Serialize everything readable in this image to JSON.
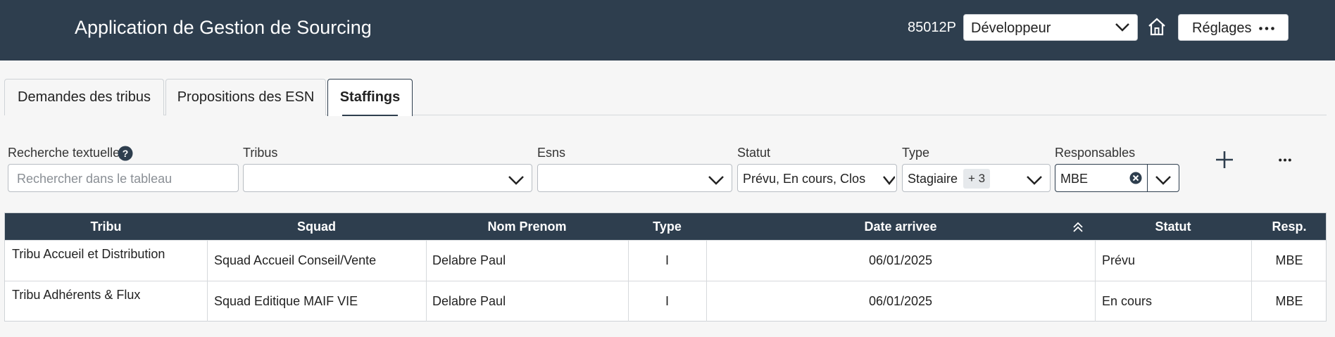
{
  "header": {
    "title": "Application de Gestion de Sourcing",
    "user_id": "85012P",
    "role": "Développeur",
    "settings_label": "Réglages"
  },
  "tabs": [
    {
      "label": "Demandes des tribus"
    },
    {
      "label": "Propositions des ESN"
    },
    {
      "label": "Staffings",
      "active": true
    }
  ],
  "filters": {
    "search": {
      "label": "Recherche textuelle",
      "placeholder": "Rechercher dans le tableau"
    },
    "tribus": {
      "label": "Tribus",
      "value": ""
    },
    "esns": {
      "label": "Esns",
      "value": ""
    },
    "statut": {
      "label": "Statut",
      "value": "Prévu, En cours, Clos"
    },
    "type": {
      "label": "Type",
      "value": "Stagiaire",
      "extra_count": "+ 3"
    },
    "responsables": {
      "label": "Responsables",
      "value": "MBE"
    }
  },
  "table": {
    "columns": [
      "Tribu",
      "Squad",
      "Nom Prenom",
      "Type",
      "Date arrivee",
      "Statut",
      "Resp."
    ],
    "rows": [
      [
        "Tribu Accueil et Distribution",
        "Squad Accueil Conseil/Vente",
        "Delabre Paul",
        "I",
        "06/01/2025",
        "Prévu",
        "MBE"
      ],
      [
        "Tribu Adhérents & Flux",
        "Squad Editique MAIF VIE",
        "Delabre Paul",
        "I",
        "06/01/2025",
        "En cours",
        "MBE"
      ]
    ]
  },
  "icons": {
    "role_chevron": "chevron-down-icon",
    "home": "home-icon",
    "settings_more": "more-horizontal-icon",
    "help": "help-icon",
    "clear": "clear-icon",
    "add": "add-icon",
    "sort": "sort-ascending-icon"
  },
  "colors": {
    "header_bg": "#2e3e4e",
    "page_bg": "#f6f6f6"
  }
}
